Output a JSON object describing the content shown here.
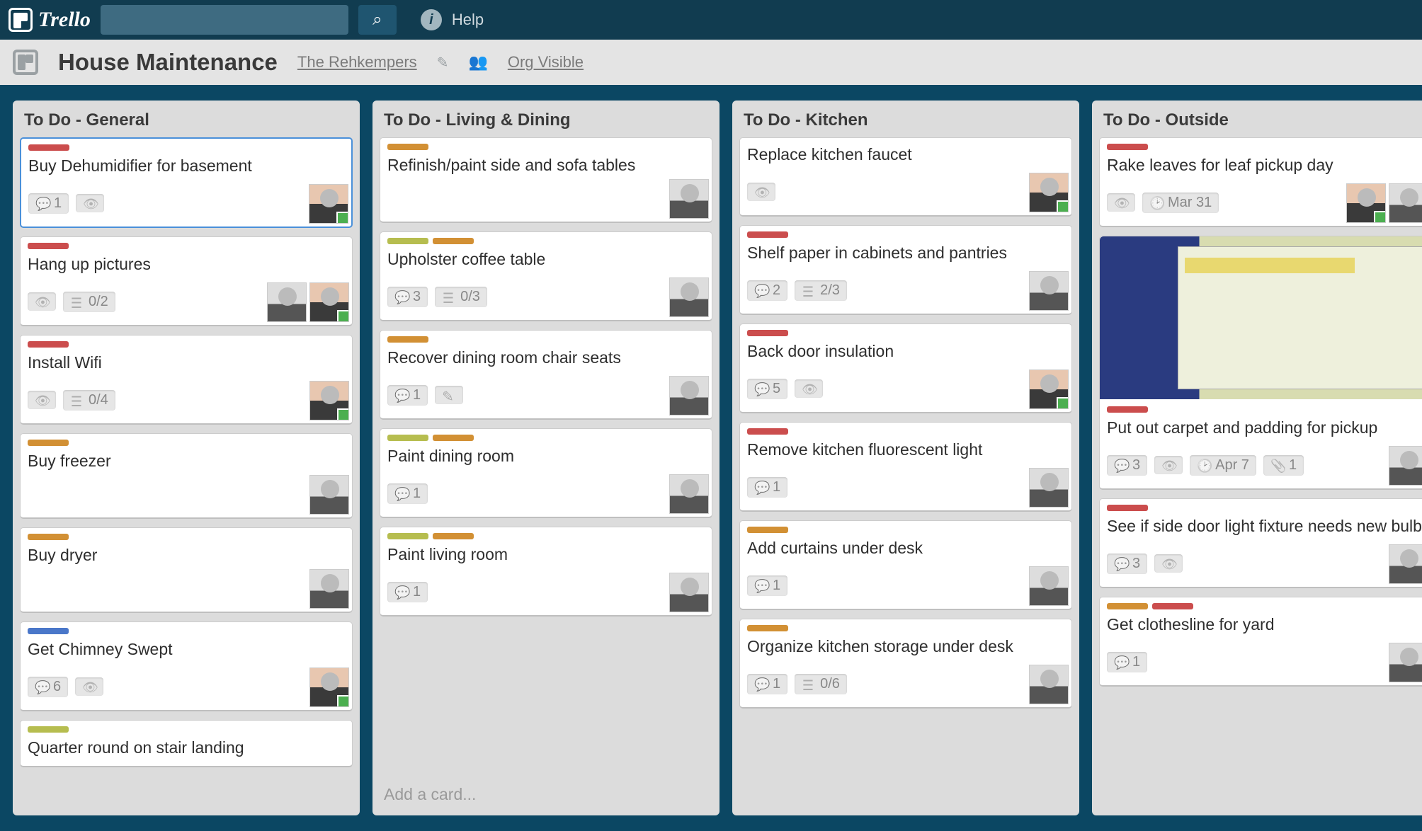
{
  "app": {
    "logo_text": "Trello",
    "help_label": "Help"
  },
  "board": {
    "title": "House Maintenance",
    "org": "The Rehkempers",
    "visibility": "Org Visible"
  },
  "lists": [
    {
      "title": "To Do - General",
      "add_card_label": "",
      "cards": [
        {
          "labels": [
            "red"
          ],
          "title": "Buy Dehumidifier for basement",
          "comments": "1",
          "watch": true,
          "members": [
            "m2"
          ],
          "highlight": true
        },
        {
          "labels": [
            "red"
          ],
          "title": "Hang up pictures",
          "watch": true,
          "checklist": "0/2",
          "members": [
            "m1",
            "m2"
          ]
        },
        {
          "labels": [
            "red"
          ],
          "title": "Install Wifi",
          "watch": true,
          "checklist": "0/4",
          "members": [
            "m2"
          ]
        },
        {
          "labels": [
            "orange"
          ],
          "title": "Buy freezer",
          "members": [
            "m1"
          ]
        },
        {
          "labels": [
            "orange"
          ],
          "title": "Buy dryer",
          "members": [
            "m1"
          ]
        },
        {
          "labels": [
            "blue"
          ],
          "title": "Get Chimney Swept",
          "comments": "6",
          "watch": true,
          "members": [
            "m2"
          ]
        },
        {
          "labels": [
            "yellow-green"
          ],
          "title": "Quarter round on stair landing"
        }
      ]
    },
    {
      "title": "To Do - Living & Dining",
      "add_card_label": "Add a card...",
      "cards": [
        {
          "labels": [
            "orange"
          ],
          "title": "Refinish/paint side and sofa tables",
          "members": [
            "m1"
          ]
        },
        {
          "labels": [
            "yellow-green",
            "orange"
          ],
          "title": "Upholster coffee table",
          "comments": "3",
          "checklist": "0/3",
          "members": [
            "m1"
          ]
        },
        {
          "labels": [
            "orange"
          ],
          "title": "Recover dining room chair seats",
          "comments": "1",
          "pencil": true,
          "members": [
            "m1"
          ]
        },
        {
          "labels": [
            "yellow-green",
            "orange"
          ],
          "title": "Paint dining room",
          "comments": "1",
          "members": [
            "m1"
          ]
        },
        {
          "labels": [
            "yellow-green",
            "orange"
          ],
          "title": "Paint living room",
          "comments": "1",
          "members": [
            "m1"
          ]
        }
      ]
    },
    {
      "title": "To Do - Kitchen",
      "add_card_label": "",
      "cards": [
        {
          "labels": [],
          "title": "Replace kitchen faucet",
          "watch": true,
          "members": [
            "m2"
          ]
        },
        {
          "labels": [
            "red"
          ],
          "title": "Shelf paper in cabinets and pantries",
          "comments": "2",
          "checklist": "2/3",
          "members": [
            "m1"
          ]
        },
        {
          "labels": [
            "red"
          ],
          "title": "Back door insulation",
          "comments": "5",
          "watch": true,
          "members": [
            "m2"
          ]
        },
        {
          "labels": [
            "red"
          ],
          "title": "Remove kitchen fluorescent light",
          "comments": "1",
          "members": [
            "m1"
          ]
        },
        {
          "labels": [
            "orange"
          ],
          "title": "Add curtains under desk",
          "comments": "1",
          "members": [
            "m1"
          ]
        },
        {
          "labels": [
            "orange"
          ],
          "title": "Organize kitchen storage under desk",
          "comments": "1",
          "checklist": "0/6",
          "members": [
            "m1"
          ]
        }
      ]
    },
    {
      "title": "To Do - Outside",
      "add_card_label": "",
      "cards": [
        {
          "labels": [
            "red"
          ],
          "title": "Rake leaves for leaf pickup day",
          "watch": true,
          "due": "Mar 31",
          "members": [
            "m2",
            "m1"
          ]
        },
        {
          "labels": [
            "red"
          ],
          "title": "Put out carpet and padding for pickup",
          "cover": true,
          "comments": "3",
          "watch": true,
          "due": "Apr 7",
          "attach": "1",
          "members": [
            "m1"
          ]
        },
        {
          "labels": [
            "red"
          ],
          "title": "See if side door light fixture needs new bulb",
          "comments": "3",
          "watch": true,
          "members": [
            "m1"
          ]
        },
        {
          "labels": [
            "orange",
            "red"
          ],
          "title": "Get clothesline for yard",
          "comments": "1",
          "members": [
            "m1"
          ]
        }
      ]
    }
  ]
}
